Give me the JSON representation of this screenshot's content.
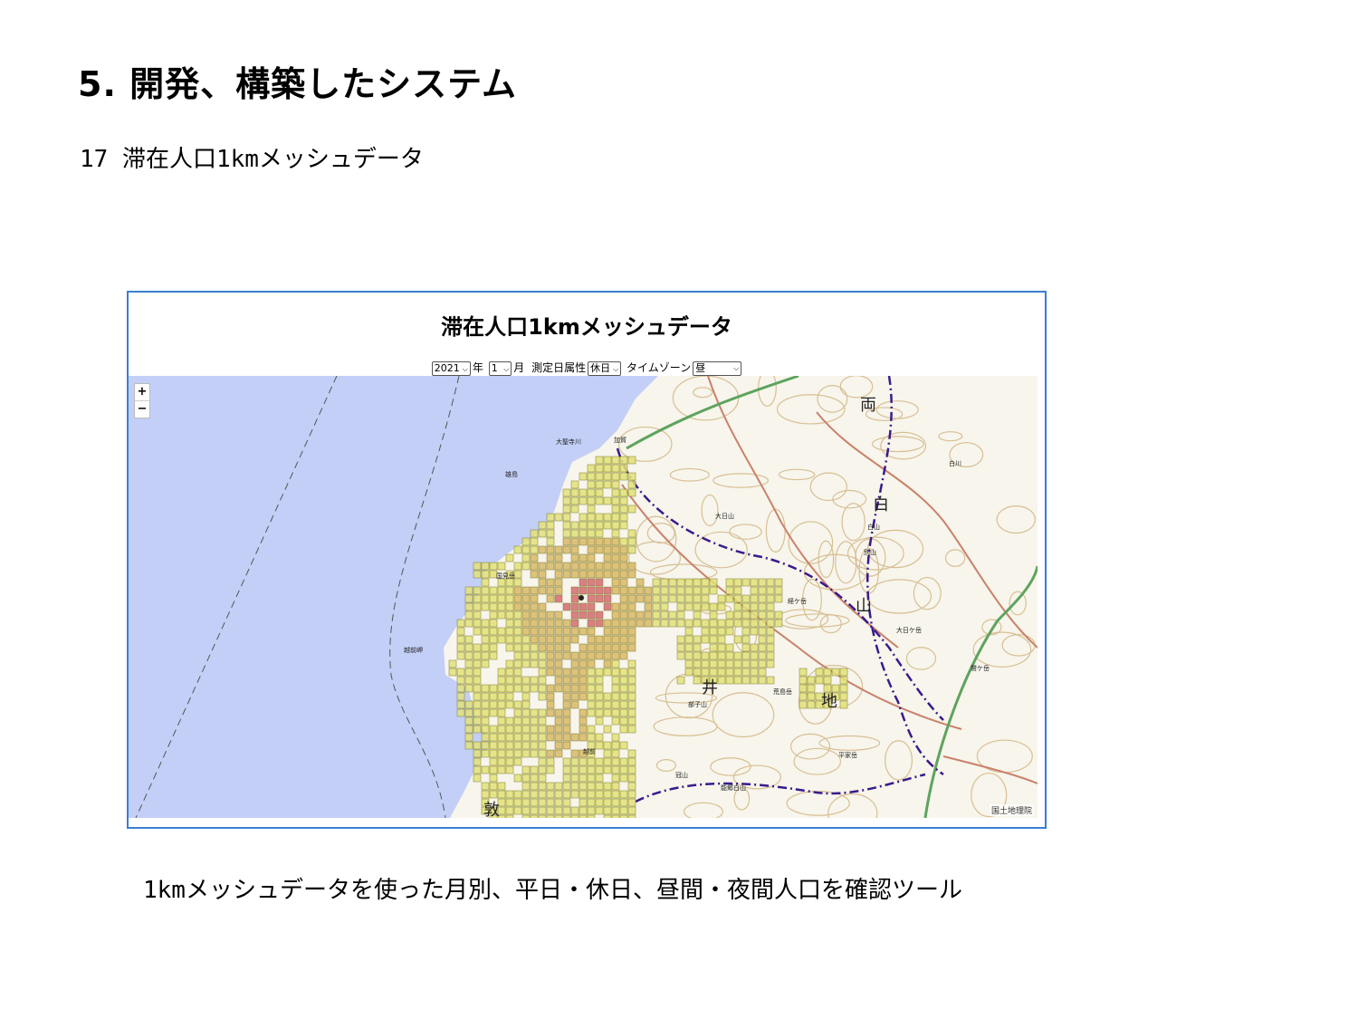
{
  "slide": {
    "title": "5. 開発、構築したシステム",
    "subtitle": "17 滞在人口1kmメッシュデータ",
    "caption": "1kmメッシュデータを使った月別、平日・休日、昼間・夜間人口を確認ツール"
  },
  "app": {
    "title": "滞在人口1kmメッシュデータ",
    "controls": {
      "year_value": "2021",
      "year_label": "年",
      "month_value": "1",
      "month_label": "月",
      "day_attr_label": "測定日属性",
      "day_attr_value": "休日",
      "timezone_label": "タイムゾーン",
      "timezone_value": "昼"
    },
    "map": {
      "zoom_in": "+",
      "zoom_out": "−",
      "attribution": "国土地理院",
      "big_labels": [
        "両",
        "白",
        "山",
        "井",
        "地",
        "敦"
      ],
      "place_labels": [
        "大聖寺川",
        "加賀",
        "雄島",
        "国見岳",
        "越前岬",
        "大日山",
        "白山",
        "別山",
        "大日ケ岳",
        "荒島岳",
        "部子山",
        "冠山",
        "能郷白山",
        "平家岳",
        "越前",
        "経ケ岳",
        "鷲ケ岳",
        "白川"
      ],
      "colors": {
        "sea": "#c3cff7",
        "land": "#f7f5ec",
        "mesh_low": "#e3e07a",
        "mesh_mid": "#d9b966",
        "mesh_high": "#d66a72",
        "boundary": "#3a1a8c",
        "contour": "#d8bf93",
        "road": "#c9826b"
      }
    }
  }
}
